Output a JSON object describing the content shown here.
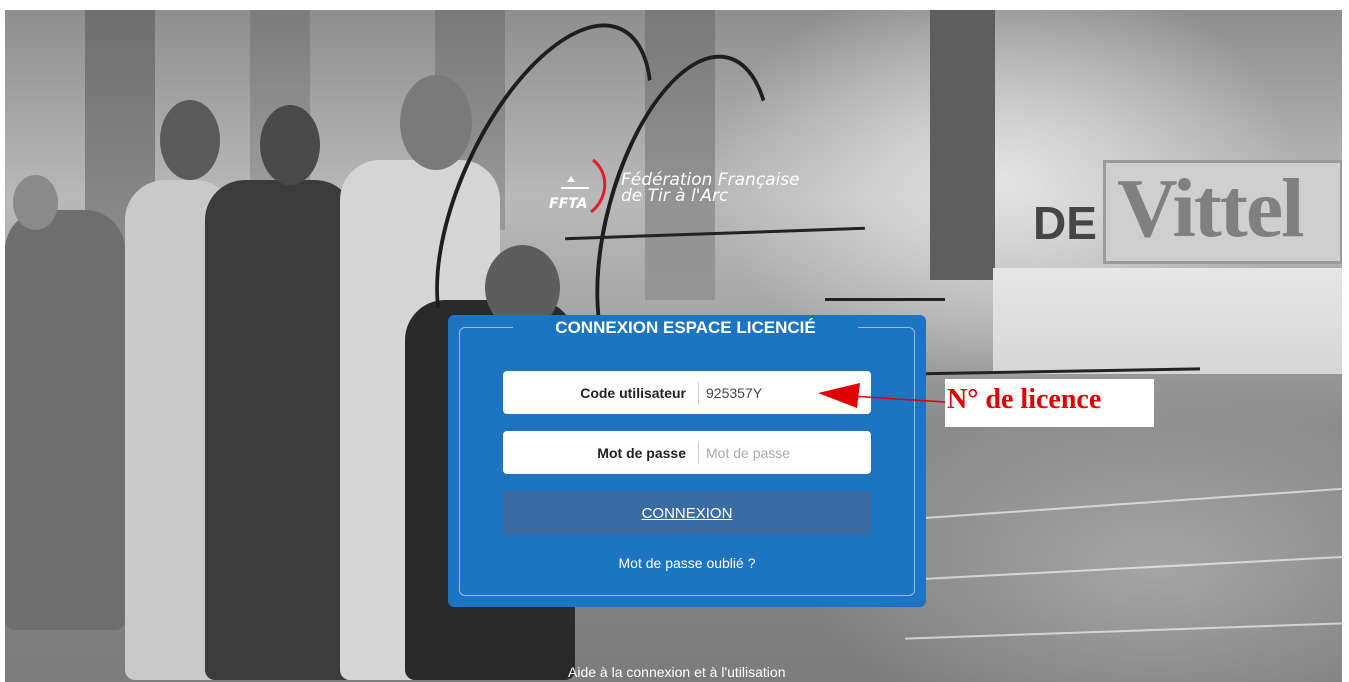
{
  "logo": {
    "abbr": "FFTA",
    "name_line1": "Fédération Française",
    "name_line2": "de Tir à l'Arc"
  },
  "background": {
    "sign_de": "DE",
    "sign_vittel": "Vittel"
  },
  "login": {
    "title": "CONNEXION ESPACE LICENCIÉ",
    "user_label": "Code utilisateur",
    "user_value": "925357Y",
    "password_label": "Mot de passe",
    "password_placeholder": "Mot de passe",
    "submit_label": "CONNEXION",
    "forgot_label": "Mot de passe oublié ?"
  },
  "annotation": {
    "text": "N° de licence",
    "color": "#e00000"
  },
  "footer": {
    "help_label": "Aide à la connexion et à l'utilisation"
  },
  "colors": {
    "card": "#1d74c0",
    "button": "#3a6ca3"
  }
}
